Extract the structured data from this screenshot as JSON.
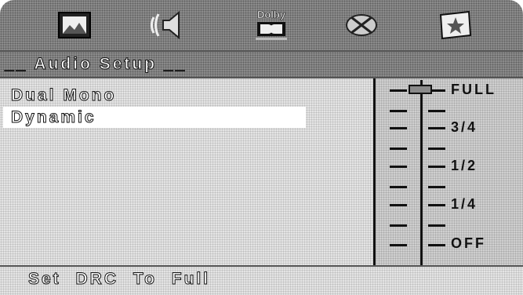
{
  "tabs": [
    {
      "icon": "picture-icon"
    },
    {
      "icon": "speaker-sound-icon"
    },
    {
      "icon": "dolby-icon",
      "label": "Dolby"
    },
    {
      "icon": "disc-crossed-icon"
    },
    {
      "icon": "star-card-icon"
    }
  ],
  "header": {
    "title": "__ Audio Setup __"
  },
  "menu": {
    "items": [
      {
        "label": "Dual Mono",
        "selected": false
      },
      {
        "label": "Dynamic",
        "selected": true
      }
    ]
  },
  "drc_slider": {
    "labels": [
      "FULL",
      "3/4",
      "1/2",
      "1/4",
      "OFF"
    ],
    "current": "FULL",
    "level": 1.0
  },
  "status": {
    "text": "Set DRC To Full"
  }
}
